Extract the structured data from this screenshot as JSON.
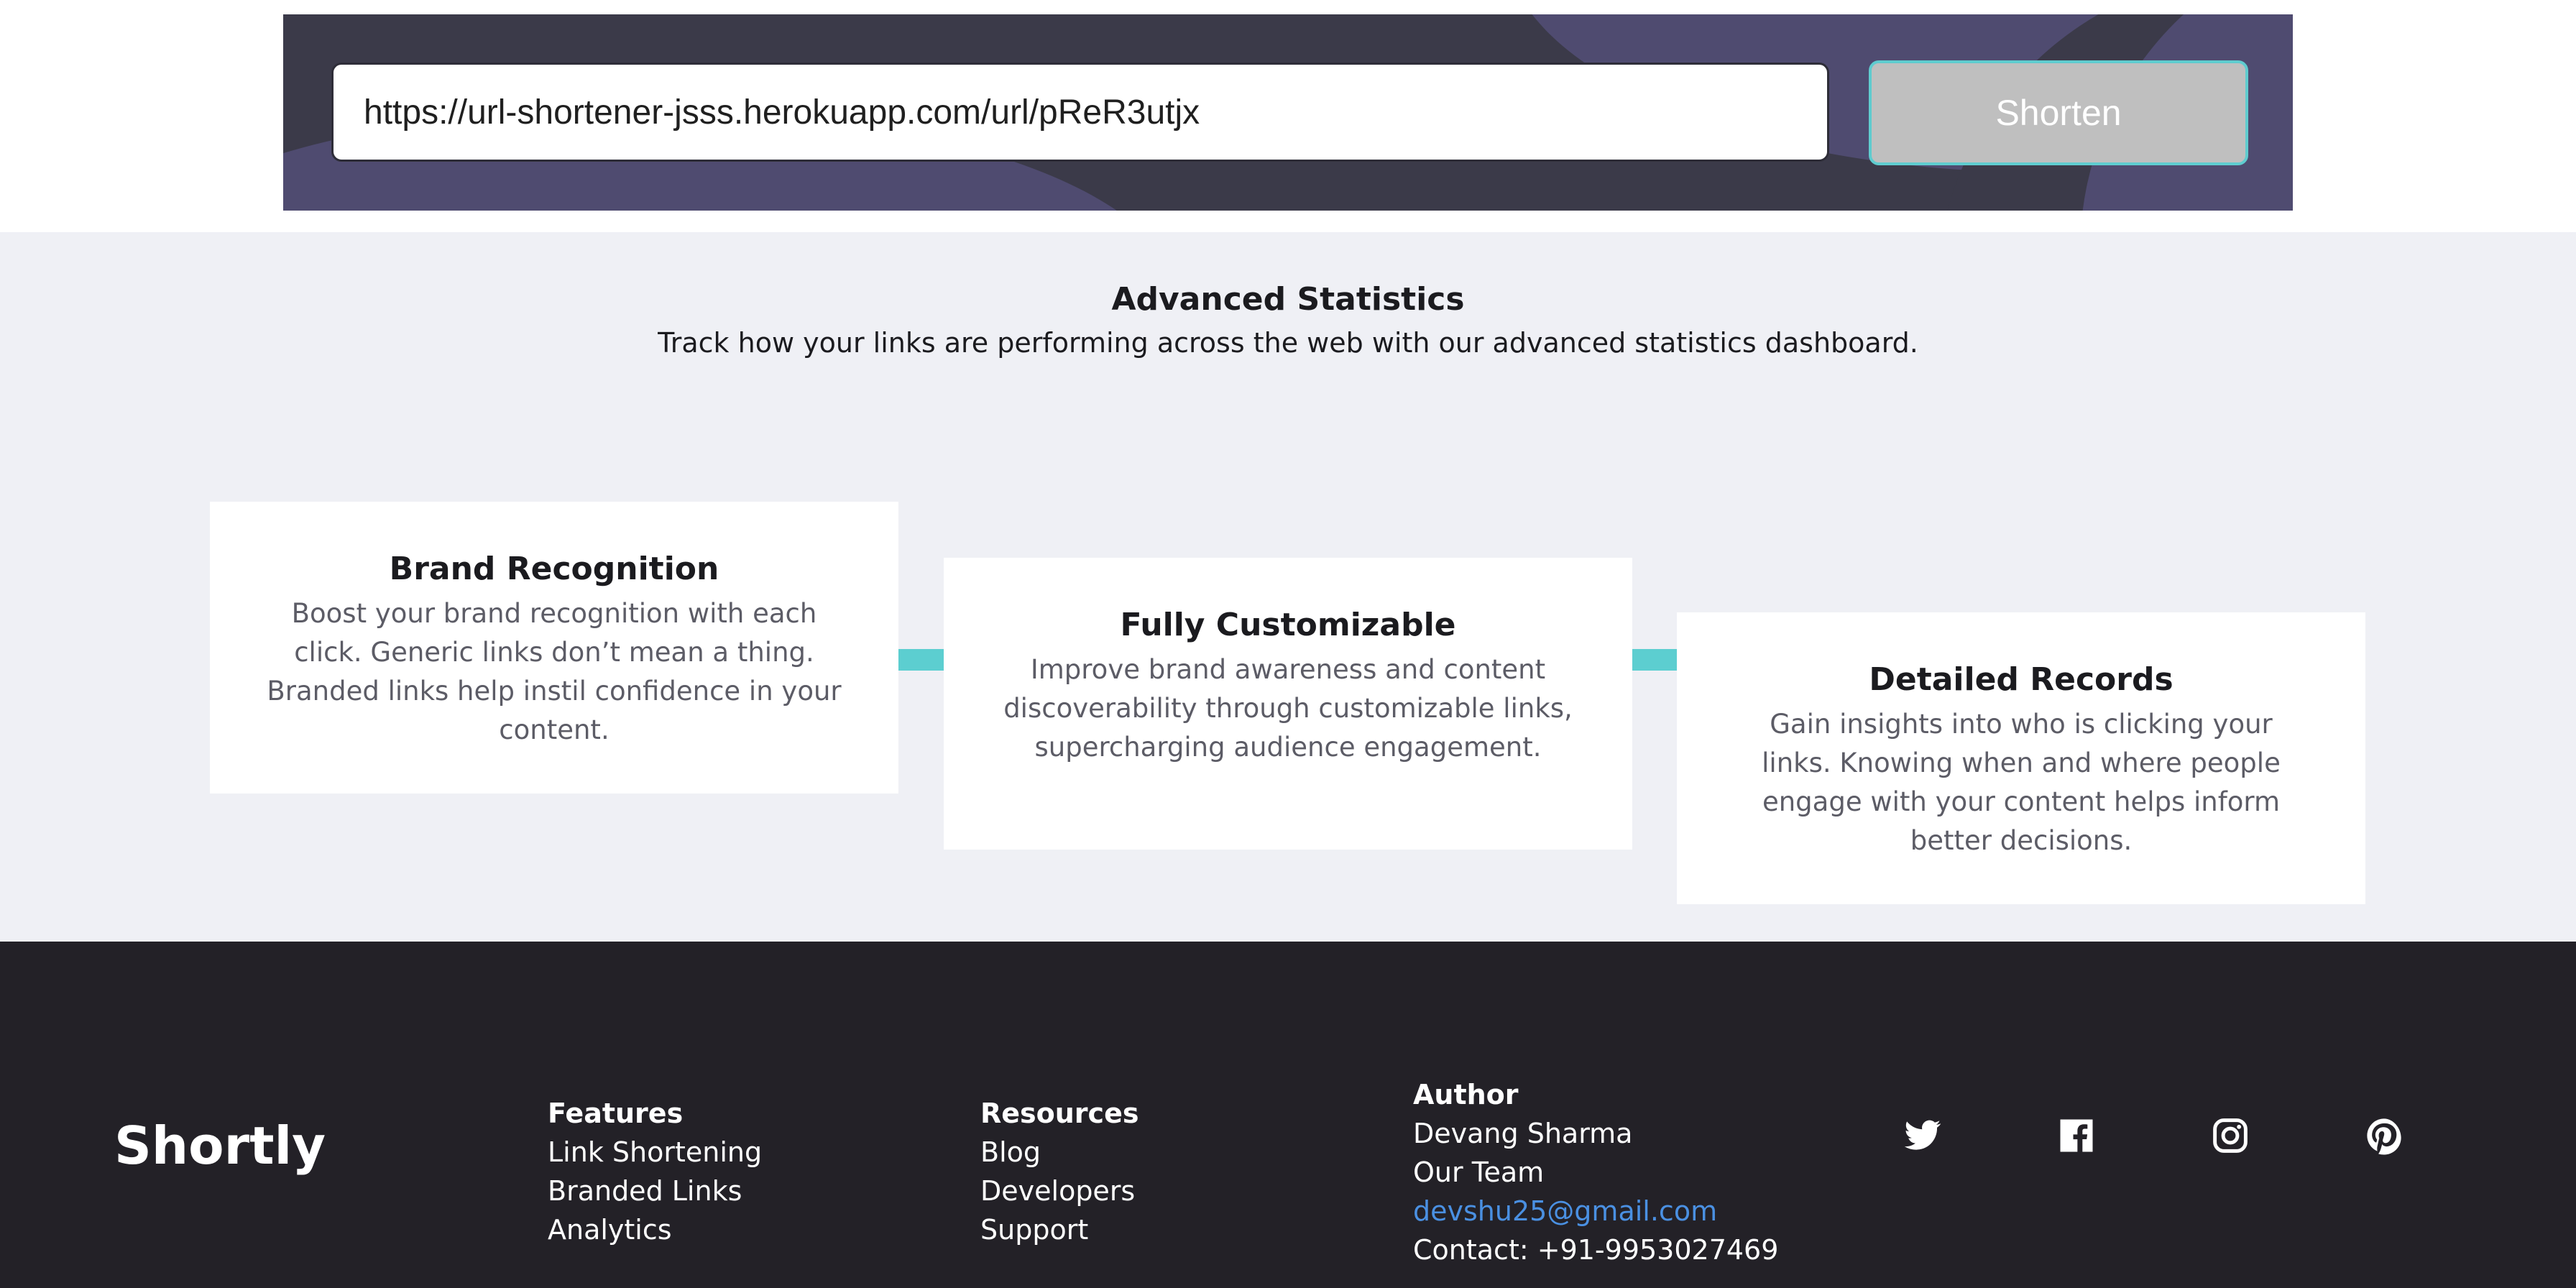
{
  "shortener": {
    "url_value": "https://url-shortener-jsss.herokuapp.com/url/pReR3utjx",
    "button_label": "Shorten"
  },
  "stats": {
    "title": "Advanced Statistics",
    "subtitle": "Track how your links are performing across the web with our advanced statistics dashboard.",
    "cards": [
      {
        "title": "Brand Recognition",
        "body": "Boost your brand recognition with each click. Generic links don’t mean a thing. Branded links help instil confidence in your content."
      },
      {
        "title": "Fully Customizable",
        "body": "Improve brand awareness and content discoverability through customizable links, supercharging audience engagement."
      },
      {
        "title": "Detailed Records",
        "body": "Gain insights into who is clicking your links. Knowing when and where people engage with your content helps inform better decisions."
      }
    ]
  },
  "footer": {
    "logo": "Shortly",
    "features": {
      "title": "Features",
      "links": [
        "Link Shortening",
        "Branded Links",
        "Analytics"
      ]
    },
    "resources": {
      "title": "Resources",
      "links": [
        "Blog",
        "Developers",
        "Support"
      ]
    },
    "author": {
      "title": "Author",
      "name": "Devang Sharma",
      "team": "Our Team",
      "email": "devshu25@gmail.com",
      "contact": "Contact: +91-9953027469"
    },
    "social": [
      "twitter-icon",
      "facebook-icon",
      "instagram-icon",
      "pinterest-icon"
    ]
  },
  "colors": {
    "accent": "#5cced0",
    "banner": "#3b3a49",
    "footer": "#232127",
    "email_link": "#4a90e2"
  }
}
